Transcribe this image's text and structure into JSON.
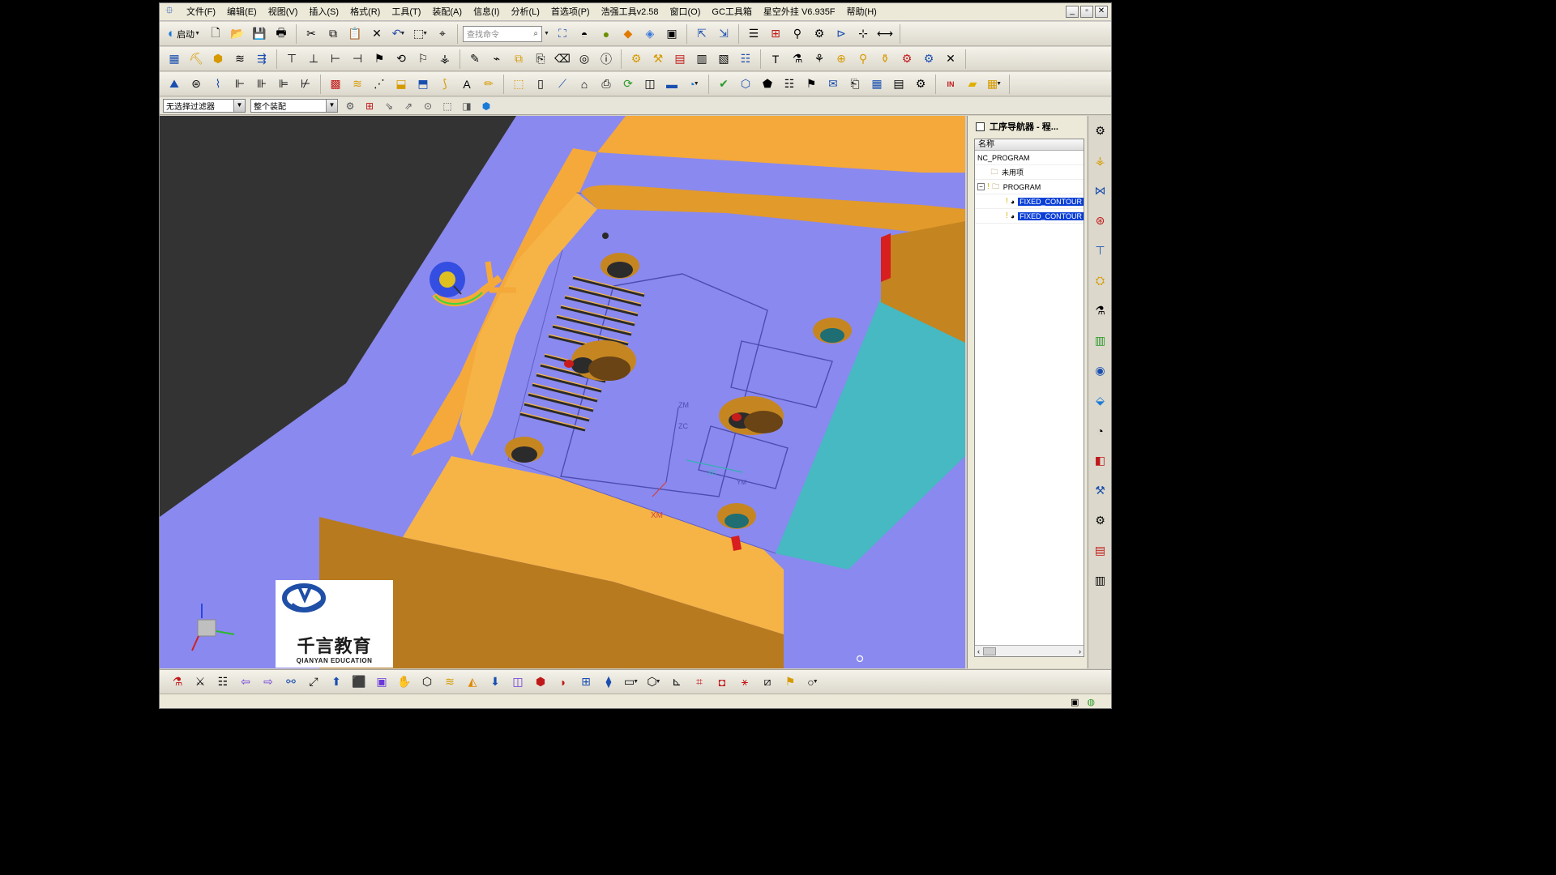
{
  "menubar": {
    "items": [
      "文件(F)",
      "编辑(E)",
      "视图(V)",
      "插入(S)",
      "格式(R)",
      "工具(T)",
      "装配(A)",
      "信息(I)",
      "分析(L)",
      "首选项(P)",
      "浩强工具v2.58",
      "窗口(O)",
      "GC工具箱",
      "星空外挂 V6.935F",
      "帮助(H)"
    ]
  },
  "window_controls": {
    "minimize": "_",
    "restore": "▫",
    "close": "✕"
  },
  "toolbar": {
    "start_label": "启动",
    "search_placeholder": "查找命令"
  },
  "selection_bar": {
    "filter_value": "无选择过滤器",
    "scope_value": "整个装配"
  },
  "viewport": {
    "labels": {
      "zm": "ZM",
      "zc": "ZC",
      "xm": "XM",
      "xc": "XC",
      "ym": "YM"
    }
  },
  "logo": {
    "cn": "千言教育",
    "en": "QIANYAN EDUCATION"
  },
  "navigator": {
    "title": "工序导航器 - 程...",
    "column_name": "名称",
    "rows": [
      {
        "label": "NC_PROGRAM",
        "depth": 0
      },
      {
        "label": "未用项",
        "depth": 1
      },
      {
        "label": "PROGRAM",
        "depth": 1
      },
      {
        "label": "FIXED_CONTOUR",
        "depth": 2,
        "selected": true
      },
      {
        "label": "FIXED_CONTOUR",
        "depth": 2,
        "selected": true
      }
    ],
    "scroll_left": "‹",
    "scroll_right": "›"
  },
  "colors": {
    "model_blue": "#8a89ef",
    "model_orange": "#f4a93a",
    "model_cyan": "#46b9c2",
    "viewport_bg": "#333333",
    "selection": "#0a3fd6"
  },
  "icons": {
    "toolbar1": [
      "start-icon",
      "new-icon",
      "open-icon",
      "save-icon",
      "print-icon",
      "cut-icon",
      "copy-icon",
      "paste-icon",
      "delete-icon",
      "undo-icon",
      "select-icon",
      "command-finder-icon",
      "fit-icon",
      "render-style-icon",
      "shaded-icon",
      "edge-icon",
      "view-icon",
      "wcs-icon",
      "layer-icon",
      "background-icon",
      "measure-icon"
    ],
    "resource_bar": [
      "assembly-navigator-icon",
      "constraint-navigator-icon",
      "part-navigator-icon",
      "operation-navigator-icon",
      "machine-tool-icon",
      "reuse-library-icon",
      "history-icon",
      "web-icon",
      "roles-icon",
      "system-materials-icon",
      "clock-icon",
      "palette-icon",
      "mold-wizard-icon",
      "manufacturing-icon",
      "process-icon",
      "report-icon"
    ]
  }
}
